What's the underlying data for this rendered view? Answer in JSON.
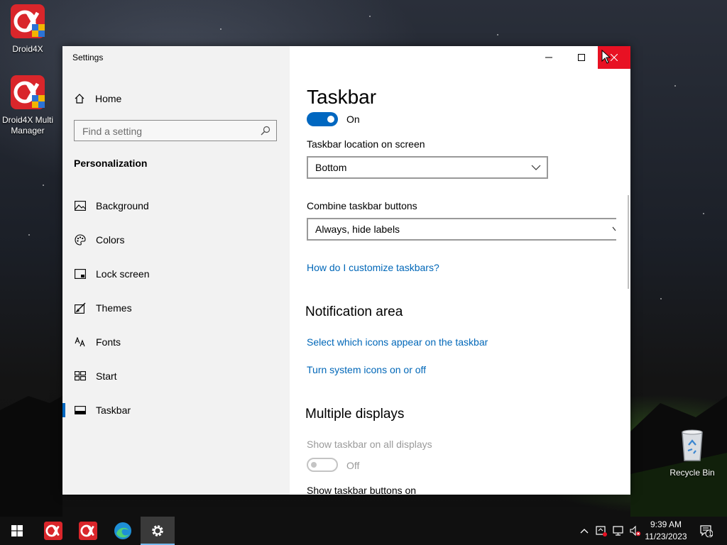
{
  "desktop": {
    "icons": [
      {
        "label": "Droid4X",
        "icon": "droid4x-icon"
      },
      {
        "label": "Droid4X Multi Manager",
        "icon": "droid4x-multi-manager-icon"
      },
      {
        "label": "Recycle Bin",
        "icon": "recycle-bin-icon"
      }
    ]
  },
  "window": {
    "title": "Settings",
    "caption_buttons": [
      "minimize",
      "maximize",
      "close"
    ]
  },
  "sidebar": {
    "home_label": "Home",
    "search_placeholder": "Find a setting",
    "section_title": "Personalization",
    "items": [
      {
        "label": "Background",
        "icon": "picture-icon",
        "selected": false
      },
      {
        "label": "Colors",
        "icon": "palette-icon",
        "selected": false
      },
      {
        "label": "Lock screen",
        "icon": "lock-screen-icon",
        "selected": false
      },
      {
        "label": "Themes",
        "icon": "themes-brush-icon",
        "selected": false
      },
      {
        "label": "Fonts",
        "icon": "fonts-icon",
        "selected": false
      },
      {
        "label": "Start",
        "icon": "start-layout-icon",
        "selected": false
      },
      {
        "label": "Taskbar",
        "icon": "taskbar-icon",
        "selected": true
      }
    ]
  },
  "content": {
    "title": "Taskbar",
    "top_toggle_state": "On",
    "location_label": "Taskbar location on screen",
    "location_value": "Bottom",
    "combine_label": "Combine taskbar buttons",
    "combine_value": "Always, hide labels",
    "customize_link": "How do I customize taskbars?",
    "notification_heading": "Notification area",
    "select_icons_link": "Select which icons appear on the taskbar",
    "system_icons_link": "Turn system icons on or off",
    "multiple_heading": "Multiple displays",
    "show_all_label": "Show taskbar on all displays",
    "show_all_state": "Off",
    "show_buttons_label": "Show taskbar buttons on"
  },
  "taskbar": {
    "pinned": [
      "start-icon",
      "droid4x-icon",
      "droid4x-multi-manager-icon",
      "edge-icon",
      "settings-gear-icon"
    ],
    "active": "settings-gear-icon",
    "time": "9:39 AM",
    "date": "11/23/2023",
    "notification_count": "1",
    "accent_color": "#0067c0"
  }
}
